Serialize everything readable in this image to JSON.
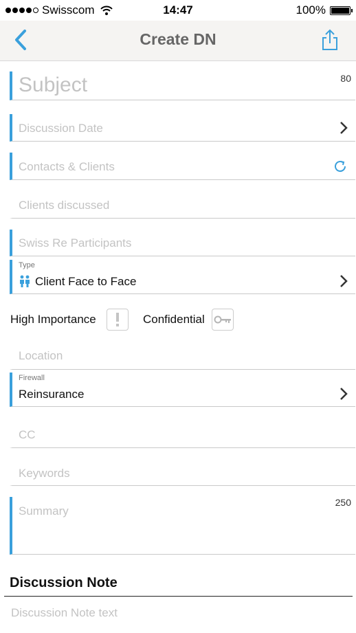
{
  "status_bar": {
    "carrier": "Swisscom",
    "time": "14:47",
    "battery": "100%",
    "battery_level": 1.0,
    "signal_bars_filled": 4,
    "signal_bars_total": 5
  },
  "nav": {
    "title": "Create DN",
    "back_icon": "chevron-left-icon",
    "share_icon": "share-icon",
    "accent_color": "#3aa0dc"
  },
  "form": {
    "subject": {
      "placeholder": "Subject",
      "counter": "80"
    },
    "discussion_date": {
      "placeholder": "Discussion Date"
    },
    "contacts_clients": {
      "placeholder": "Contacts & Clients"
    },
    "clients_discussed": {
      "placeholder": "Clients discussed"
    },
    "swiss_re_participants": {
      "placeholder": "Swiss Re Participants"
    },
    "type": {
      "label": "Type",
      "value": "Client Face to Face"
    },
    "high_importance": {
      "label": "High Importance"
    },
    "confidential": {
      "label": "Confidential"
    },
    "location": {
      "placeholder": "Location"
    },
    "firewall": {
      "label": "Firewall",
      "value": "Reinsurance"
    },
    "cc": {
      "placeholder": "CC"
    },
    "keywords": {
      "placeholder": "Keywords"
    },
    "summary": {
      "placeholder": "Summary",
      "counter": "250"
    }
  },
  "discussion_note": {
    "title": "Discussion Note",
    "placeholder": "Discussion Note text"
  }
}
